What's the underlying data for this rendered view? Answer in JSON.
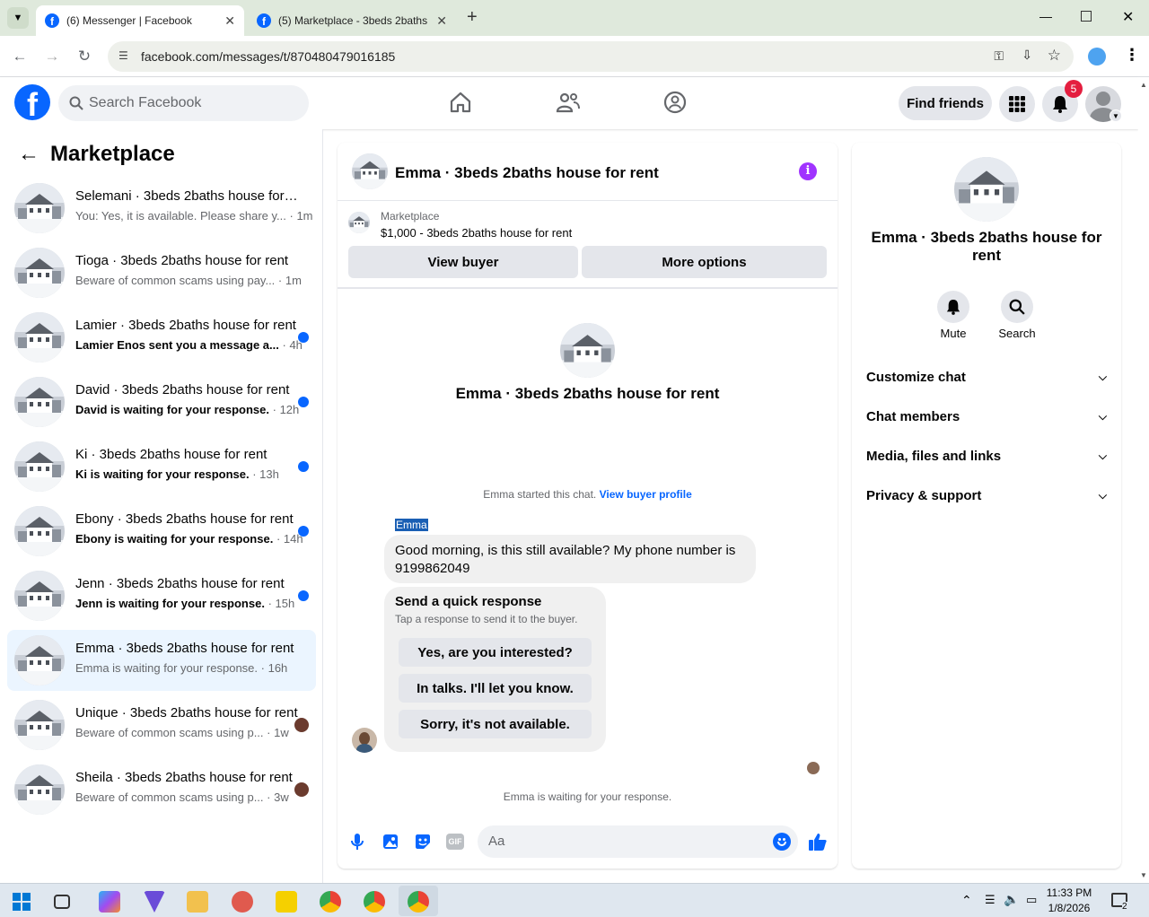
{
  "browser": {
    "tabs": [
      {
        "label": "(6) Messenger | Facebook",
        "active": true
      },
      {
        "label": "(5) Marketplace - 3beds 2baths",
        "active": false
      }
    ],
    "url": "facebook.com/messages/t/870480479016185"
  },
  "header": {
    "search_placeholder": "Search Facebook",
    "find_friends": "Find friends",
    "notif_count": "5"
  },
  "sidebar": {
    "title": "Marketplace",
    "conversations": [
      {
        "title": "Selemani · 3beds 2baths house for rent",
        "snippet": "You: Yes, it is available. Please share y...",
        "time": "· 1m",
        "unread": false,
        "indicator": "none",
        "selected": false
      },
      {
        "title": "Tioga · 3beds 2baths house for rent",
        "snippet": "Beware of common scams using pay...",
        "time": "· 1m",
        "unread": false,
        "indicator": "none",
        "selected": false
      },
      {
        "title": "Lamier · 3beds 2baths house for rent",
        "snippet": "Lamier Enos sent you a message a...",
        "time": "· 4h",
        "unread": true,
        "indicator": "dot",
        "selected": false
      },
      {
        "title": "David · 3beds 2baths house for rent",
        "snippet": "David is waiting for your response.",
        "time": "· 12h",
        "unread": true,
        "indicator": "dot",
        "selected": false
      },
      {
        "title": "Ki · 3beds 2baths house for rent",
        "snippet": "Ki is waiting for your response.",
        "time": "· 13h",
        "unread": true,
        "indicator": "dot",
        "selected": false
      },
      {
        "title": "Ebony · 3beds 2baths house for rent",
        "snippet": "Ebony is waiting for your response.",
        "time": "· 14h",
        "unread": true,
        "indicator": "dot",
        "selected": false
      },
      {
        "title": "Jenn · 3beds 2baths house for rent",
        "snippet": "Jenn is waiting for your response.",
        "time": "· 15h",
        "unread": true,
        "indicator": "dot",
        "selected": false
      },
      {
        "title": "Emma · 3beds 2baths house for rent",
        "snippet": "Emma is waiting for your response.",
        "time": "· 16h",
        "unread": false,
        "indicator": "none",
        "selected": true
      },
      {
        "title": "Unique · 3beds 2baths house for rent",
        "snippet": "Beware of common scams using p...",
        "time": "· 1w",
        "unread": false,
        "indicator": "avatar",
        "selected": false
      },
      {
        "title": "Sheila · 3beds 2baths house for rent",
        "snippet": "Beware of common scams using p...",
        "time": "· 3w",
        "unread": false,
        "indicator": "avatar",
        "selected": false
      }
    ]
  },
  "chat": {
    "title": "Emma · 3beds 2baths house for rent",
    "marketplace_label": "Marketplace",
    "listing": "$1,000 - 3beds 2baths house for rent",
    "view_buyer": "View buyer",
    "more_options": "More options",
    "profile_name": "Emma · 3beds 2baths house for rent",
    "started_text": "Emma started this chat.",
    "view_buyer_profile": "View buyer profile",
    "sender": "Emma",
    "message": "Good morning, is this still available? My phone number is 9199862049",
    "quick_title": "Send a quick response",
    "quick_sub": "Tap a response to send it to the buyer.",
    "quick_responses": [
      "Yes, are you interested?",
      "In talks. I'll let you know.",
      "Sorry, it's not available."
    ],
    "waiting": "Emma is waiting for your response.",
    "composer_placeholder": "Aa"
  },
  "info": {
    "name": "Emma · 3beds 2baths house for rent",
    "mute": "Mute",
    "search": "Search",
    "sections": [
      "Customize chat",
      "Chat members",
      "Media, files and links",
      "Privacy & support"
    ]
  },
  "taskbar": {
    "time": "11:33 PM",
    "date": "1/8/2026",
    "notif": "2"
  },
  "colors": {
    "accent": "#0866ff",
    "purple": "#a033ff",
    "selected": "#ebf5ff",
    "badge": "#e41e3f"
  }
}
